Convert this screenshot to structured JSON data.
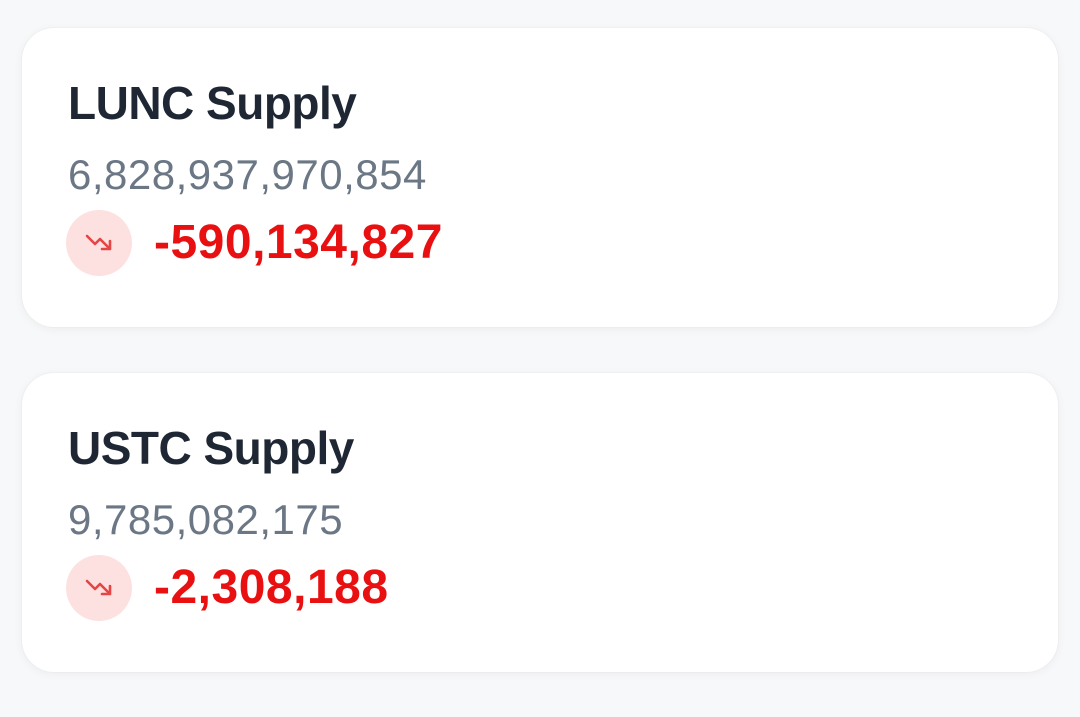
{
  "cards": [
    {
      "title": "LUNC Supply",
      "supply": "6,828,937,970,854",
      "change": "-590,134,827",
      "trend_icon": "trending-down-icon"
    },
    {
      "title": "USTC Supply",
      "supply": "9,785,082,175",
      "change": "-2,308,188",
      "trend_icon": "trending-down-icon"
    }
  ],
  "colors": {
    "title": "#1e2733",
    "supply": "#6b7785",
    "negative": "#e81010",
    "badge_bg": "#fde1e1",
    "card_bg": "#ffffff",
    "page_bg": "#f7f8fa"
  }
}
